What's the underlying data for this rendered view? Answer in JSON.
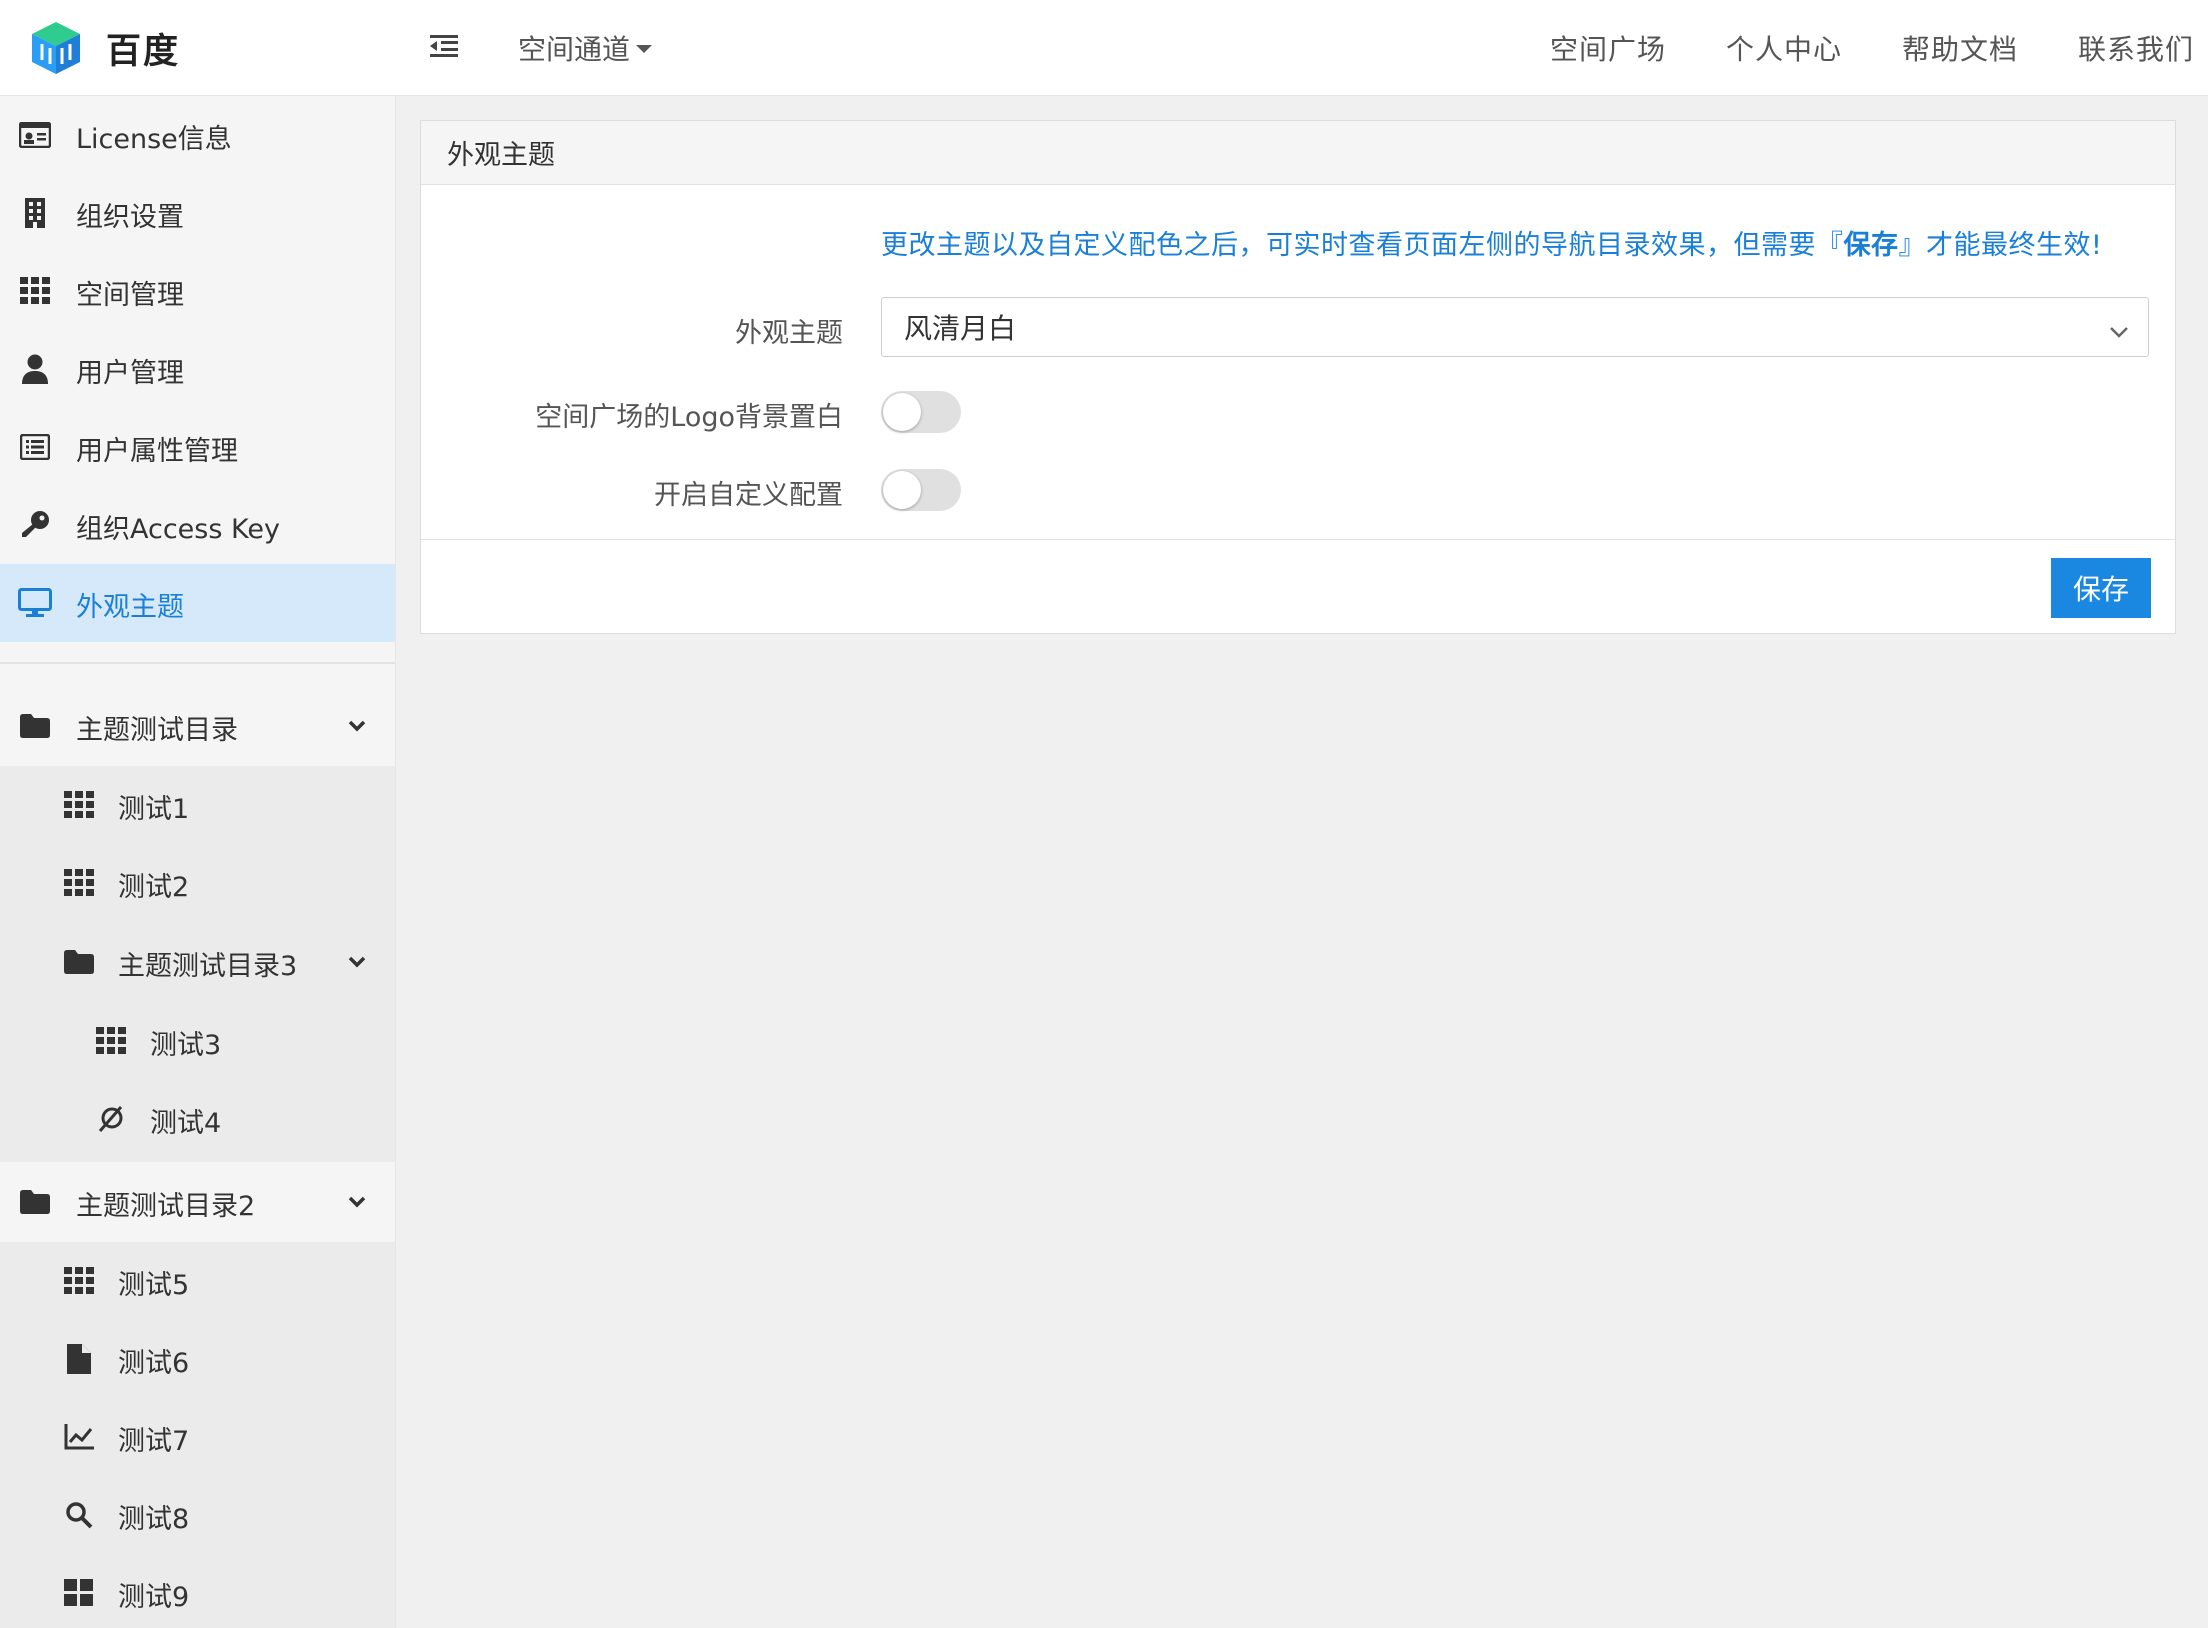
{
  "brand": {
    "name": "百度",
    "logo_icon": "cube-logo-icon"
  },
  "header": {
    "toggle_icon": "outdent-icon",
    "channel_label": "空间通道",
    "nav": [
      "空间广场",
      "个人中心",
      "帮助文档",
      "联系我们"
    ]
  },
  "sidebar": {
    "admin_items": [
      {
        "label": "License信息",
        "icon": "id-card-icon"
      },
      {
        "label": "组织设置",
        "icon": "building-icon"
      },
      {
        "label": "空间管理",
        "icon": "grid-icon"
      },
      {
        "label": "用户管理",
        "icon": "user-icon"
      },
      {
        "label": "用户属性管理",
        "icon": "list-icon"
      },
      {
        "label": "组织Access Key",
        "icon": "key-icon"
      },
      {
        "label": "外观主题",
        "icon": "monitor-icon",
        "active": true
      }
    ],
    "tree": {
      "folder1": {
        "label": "主题测试目录",
        "icon": "folder-icon",
        "expanded": true
      },
      "test1": {
        "label": "测试1",
        "icon": "grid-icon"
      },
      "test2": {
        "label": "测试2",
        "icon": "grid-icon"
      },
      "folder3": {
        "label": "主题测试目录3",
        "icon": "folder-icon",
        "expanded": true
      },
      "test3": {
        "label": "测试3",
        "icon": "grid-icon"
      },
      "test4": {
        "label": "测试4",
        "icon": "orbit-icon"
      },
      "folder2": {
        "label": "主题测试目录2",
        "icon": "folder-icon",
        "expanded": true
      },
      "test5": {
        "label": "测试5",
        "icon": "grid-icon"
      },
      "test6": {
        "label": "测试6",
        "icon": "file-icon"
      },
      "test7": {
        "label": "测试7",
        "icon": "line-chart-icon"
      },
      "test8": {
        "label": "测试8",
        "icon": "search-icon"
      },
      "test9": {
        "label": "测试9",
        "icon": "th-large-icon"
      }
    }
  },
  "panel": {
    "title": "外观主题",
    "notice_before": "更改主题以及自定义配色之后，可实时查看页面左侧的导航目录效果，但需要『",
    "notice_bold": "保存",
    "notice_after": "』才能最终生效!",
    "fields": {
      "theme_label": "外观主题",
      "theme_value": "风清月白",
      "logo_bg_label": "空间广场的Logo背景置白",
      "logo_bg_on": false,
      "custom_label": "开启自定义配置",
      "custom_on": false
    },
    "save_label": "保存"
  },
  "colors": {
    "accent": "#1a87e0",
    "active_bg": "#d6e9fb",
    "notice": "#1a7fd6"
  }
}
